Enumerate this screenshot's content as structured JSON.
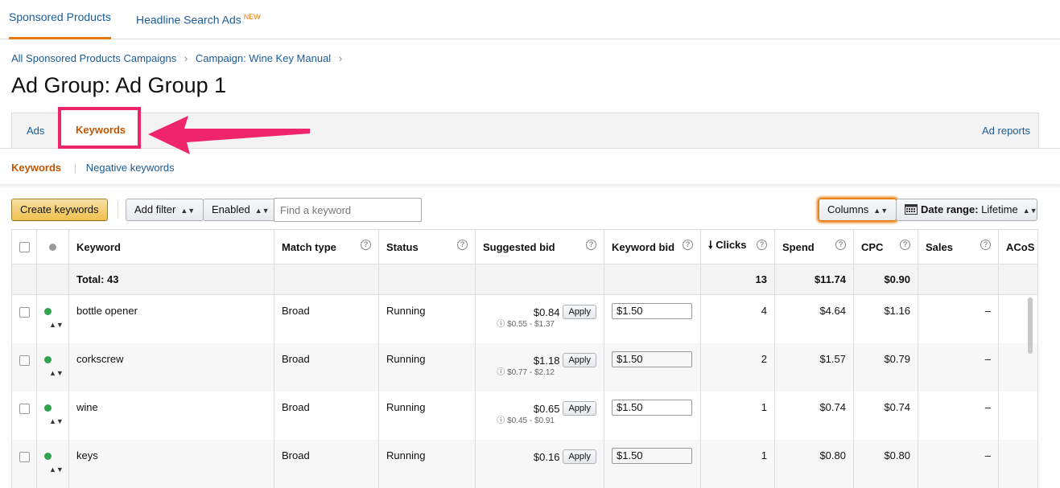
{
  "topnav": {
    "tab1": "Sponsored Products",
    "tab2": "Headline Search Ads",
    "tab2_badge": "NEW"
  },
  "breadcrumb": {
    "item1": "All Sponsored Products Campaigns",
    "item2": "Campaign: Wine Key Manual",
    "sep": "›"
  },
  "title": "Ad Group: Ad Group 1",
  "subtabs": {
    "ads": "Ads",
    "keywords": "Keywords",
    "ad_reports": "Ad reports"
  },
  "kwtabs": {
    "keywords": "Keywords",
    "negative": "Negative keywords"
  },
  "toolbar": {
    "create": "Create keywords",
    "add_filter": "Add filter",
    "enabled": "Enabled",
    "search_placeholder": "Find a keyword",
    "columns": "Columns",
    "date_label": "Date range:",
    "date_value": "Lifetime"
  },
  "table": {
    "headers": {
      "keyword": "Keyword",
      "match": "Match type",
      "status": "Status",
      "suggested": "Suggested bid",
      "bid": "Keyword bid",
      "clicks": "Clicks",
      "spend": "Spend",
      "cpc": "CPC",
      "sales": "Sales",
      "acos": "ACoS"
    },
    "total": {
      "label": "Total: 43",
      "clicks": "13",
      "spend": "$11.74",
      "cpc": "$0.90"
    },
    "rows": [
      {
        "keyword": "bottle opener",
        "match": "Broad",
        "status": "Running",
        "suggested": "$0.84",
        "range": "$0.55 - $1.37",
        "bid": "$1.50",
        "clicks": "4",
        "spend": "$4.64",
        "cpc": "$1.16",
        "sales": "–"
      },
      {
        "keyword": "corkscrew",
        "match": "Broad",
        "status": "Running",
        "suggested": "$1.18",
        "range": "$0.77 - $2.12",
        "bid": "$1.50",
        "clicks": "2",
        "spend": "$1.57",
        "cpc": "$0.79",
        "sales": "–"
      },
      {
        "keyword": "wine",
        "match": "Broad",
        "status": "Running",
        "suggested": "$0.65",
        "range": "$0.45 - $0.91",
        "bid": "$1.50",
        "clicks": "1",
        "spend": "$0.74",
        "cpc": "$0.74",
        "sales": "–"
      },
      {
        "keyword": "keys",
        "match": "Broad",
        "status": "Running",
        "suggested": "$0.16",
        "range": "",
        "bid": "$1.50",
        "clicks": "1",
        "spend": "$0.80",
        "cpc": "$0.80",
        "sales": "–"
      }
    ],
    "apply_label": "Apply"
  },
  "colors": {
    "accent": "#e47911",
    "link": "#1a5b96",
    "highlight": "#f0246b",
    "status_green": "#2ea44f"
  }
}
